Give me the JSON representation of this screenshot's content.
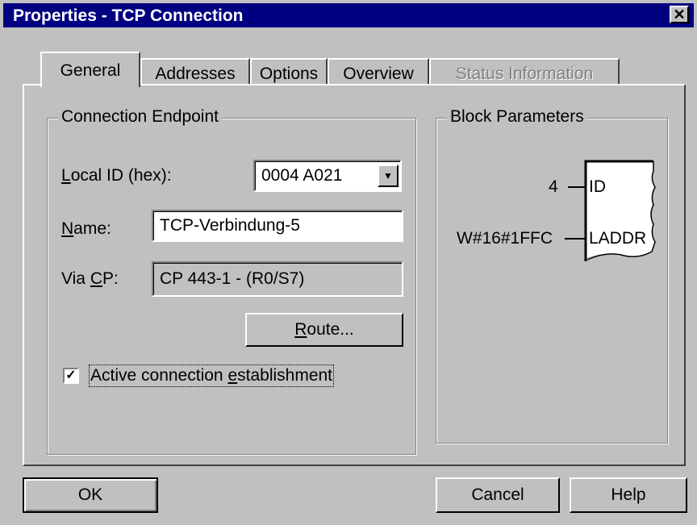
{
  "window": {
    "title": "Properties - TCP Connection",
    "close_glyph": "✕"
  },
  "tabs": [
    {
      "label": "General",
      "state": "active"
    },
    {
      "label": "Addresses",
      "state": "normal"
    },
    {
      "label": "Options",
      "state": "normal"
    },
    {
      "label": "Overview",
      "state": "normal"
    },
    {
      "label": "Status Information",
      "state": "disabled"
    }
  ],
  "connection_endpoint": {
    "title": "Connection Endpoint",
    "local_id": {
      "label_pre": "",
      "label_key": "L",
      "label_post": "ocal ID (hex):",
      "value": "0004 A021"
    },
    "name": {
      "label_pre": "",
      "label_key": "N",
      "label_post": "ame:",
      "value": "TCP-Verbindung-5"
    },
    "via_cp": {
      "label_pre": "Via ",
      "label_key": "C",
      "label_post": "P:",
      "value": "CP 443-1 - (R0/S7)"
    },
    "route_button": {
      "label_pre": "",
      "label_key": "R",
      "label_post": "oute..."
    },
    "active_connection": {
      "checked": true,
      "label_pre": "Active connection ",
      "label_key": "e",
      "label_post": "stablishment"
    }
  },
  "block_parameters": {
    "title": "Block Parameters",
    "id_value": "4",
    "id_pin": "ID",
    "laddr_value": "W#16#1FFC",
    "laddr_pin": "LADDR"
  },
  "buttons": {
    "ok": "OK",
    "cancel": "Cancel",
    "help": "Help"
  },
  "icons": {
    "dropdown": "▼",
    "checkmark": "✓"
  },
  "colors": {
    "titlebar": "#000080",
    "face": "#c0c0c0",
    "disabled_text": "#808080"
  }
}
